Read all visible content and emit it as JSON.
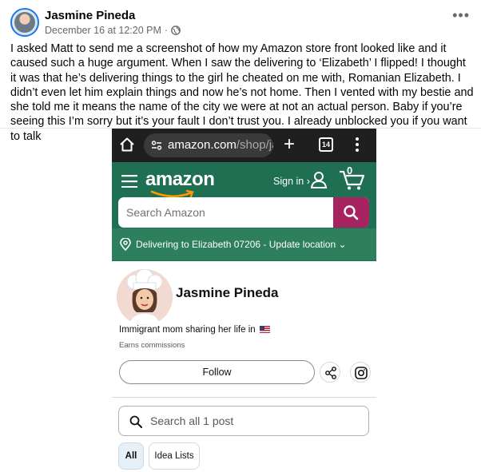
{
  "post": {
    "author": "Jasmine Pineda",
    "timestamp": "December 16 at 12:20 PM",
    "separator": "·",
    "privacy_icon": "globe-icon",
    "more_label": "•••",
    "caption": "I asked Matt to send me a screenshot of how my Amazon store front looked like and it caused such a huge argument. When I saw the delivering to ‘Elizabeth’ I flipped! I thought it was that he’s delivering things to the girl he cheated on me with, Romanian Elizabeth. I didn’t even let him explain things and now he’s not home. Then I vented with my bestie and she told me it means the name of the city we were at not an actual person. Baby if you’re seeing this I’m sorry but it’s your fault I don’t trust you. I already unblocked you if you want to talk"
  },
  "browser": {
    "url_host": "amazon.com",
    "url_path": "/shop/ja",
    "tab_count": "14",
    "new_tab_label": "+"
  },
  "amazon": {
    "logo": "amazon",
    "signin_label": "Sign in ›",
    "cart_count": "0",
    "search_placeholder": "Search Amazon",
    "delivery_text": "Delivering to Elizabeth 07206 - Update location ⌄",
    "colors": {
      "header": "#1f6f53",
      "delivery_bar": "#2e7f5e",
      "search_button": "#a6235f"
    }
  },
  "storefront": {
    "name": "Jasmine Pineda",
    "bio": "Immigrant mom sharing her life in",
    "earns": "Earns commissions",
    "follow_label": "Follow",
    "search_placeholder": "Search all 1 post",
    "filters": [
      "All",
      "Idea Lists"
    ]
  }
}
